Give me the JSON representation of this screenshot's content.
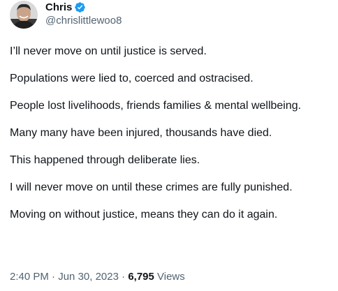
{
  "author": {
    "name": "Chris",
    "handle": "@chrislittlewoo8",
    "verified_icon": "verified-badge-icon",
    "verified_color": "#1d9bf0"
  },
  "tweet": {
    "lines": [
      "I’ll never move on until justice is served.",
      "Populations were lied to, coerced and ostracised.",
      "People lost livelihoods, friends families & mental wellbeing.",
      "Many many have been injured, thousands have died.",
      "This happened through deliberate lies.",
      "I will never move on until these crimes are fully punished.",
      "Moving on without justice, means they can do it again."
    ]
  },
  "meta": {
    "time": "2:40 PM",
    "separator1": " · ",
    "date": "Jun 30, 2023",
    "separator2": " · ",
    "views_count": "6,795",
    "views_label": " Views"
  }
}
